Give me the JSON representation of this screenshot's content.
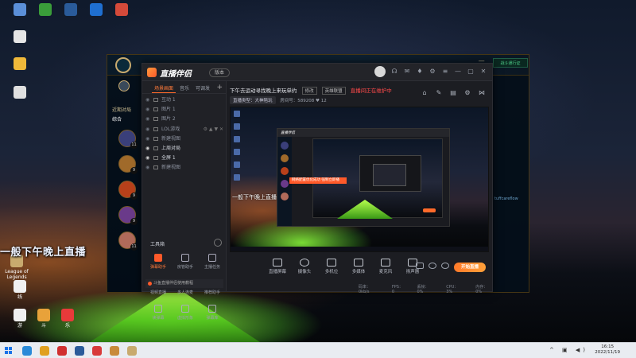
{
  "desktop": {
    "icons": [
      {
        "label": "",
        "color": "#5b8fd8"
      },
      {
        "label": "",
        "color": "#3a9d3a"
      },
      {
        "label": "",
        "color": "#2a5b9a"
      },
      {
        "label": "",
        "color": "#1f6fd0"
      },
      {
        "label": "",
        "color": "#d44a3a"
      },
      {
        "label": "",
        "color": "#e6e6e6"
      },
      {
        "label": "",
        "color": "#f0b93a"
      },
      {
        "label": "",
        "color": "#e0e0e0"
      },
      {
        "label": "League of Legends",
        "color": "#c8aa6e"
      },
      {
        "label": "线",
        "color": "#f0f0f0"
      },
      {
        "label": "游",
        "color": "#f0f0f0"
      },
      {
        "label": "斗",
        "color": "#e8a23a"
      },
      {
        "label": "乐",
        "color": "#e83a3a"
      }
    ],
    "overlay_text": "一般下午晚上直播"
  },
  "lol": {
    "sidebar_title": "近期对局",
    "sidebar_tab": "综合",
    "champion_levels": [
      "11",
      "9",
      "9",
      "9",
      "11"
    ],
    "champion_colors": [
      "#3a3f7a",
      "#a06a2a",
      "#b8401a",
      "#6a3a8a",
      "#b06a5a"
    ],
    "right_button": "战斗通行证",
    "right_text": "tuffcareflow",
    "window_controls": "— ▭ ✕"
  },
  "app": {
    "brand": "直播伴侣",
    "version_label": "版本",
    "left_tabs": [
      "场景画面",
      "音乐",
      "可调发"
    ],
    "scenes": [
      {
        "label": "互动 1",
        "on": false
      },
      {
        "label": "图片 1",
        "on": false
      },
      {
        "label": "图片 2",
        "on": false
      },
      {
        "label": "LOL游戏",
        "on": false
      },
      {
        "label": "新建视图",
        "on": false
      },
      {
        "label": "上周对局",
        "on": true
      },
      {
        "label": "全屏 1",
        "on": true
      },
      {
        "label": "新建视图",
        "on": false
      }
    ],
    "tools_title": "工具箱",
    "tools": [
      {
        "label": "弹幕助手",
        "hot": true
      },
      {
        "label": "房管助手",
        "hot": false
      },
      {
        "label": "主播任务",
        "hot": false
      },
      {
        "label": "视频直播",
        "hot": false
      },
      {
        "label": "多人连麦",
        "hot": false
      },
      {
        "label": "推荐助手",
        "hot": false
      },
      {
        "label": "读弹幕",
        "hot": false
      },
      {
        "label": "虚拟形象",
        "hot": false
      },
      {
        "label": "弹幕库",
        "hot": false
      }
    ],
    "ad_text": "斗鱼直播伴侣使用教程",
    "room_title": "下午去运动寻找晚上来玩单约",
    "tag1": "修改",
    "category": "英雄联盟",
    "warning": "直播间正在维护中",
    "room_line2_pill1": "直播类型：大神陪玩",
    "room_id": "房间号：589208",
    "viewers": "12",
    "toast": "网络配置优化成功  强制立即播",
    "preview_overlay": "一般下午晚上直播",
    "controls": [
      "直播屏幕",
      "摄像头",
      "多机位",
      "多媒体",
      "麦克风",
      "扬声器"
    ],
    "live_button": "开始直播",
    "status": [
      "码率：0kb/s",
      "FPS：0",
      "丢帧：0%",
      "CPU：3%",
      "内存：0%"
    ]
  },
  "taskbar": {
    "time": "16:15",
    "date": "2022/11/19",
    "apps": [
      "#2a8ad8",
      "#e0a020",
      "#d03030",
      "#2a5b9a",
      "#d83a3a",
      "#c88a3a",
      "#c8aa6e"
    ]
  }
}
